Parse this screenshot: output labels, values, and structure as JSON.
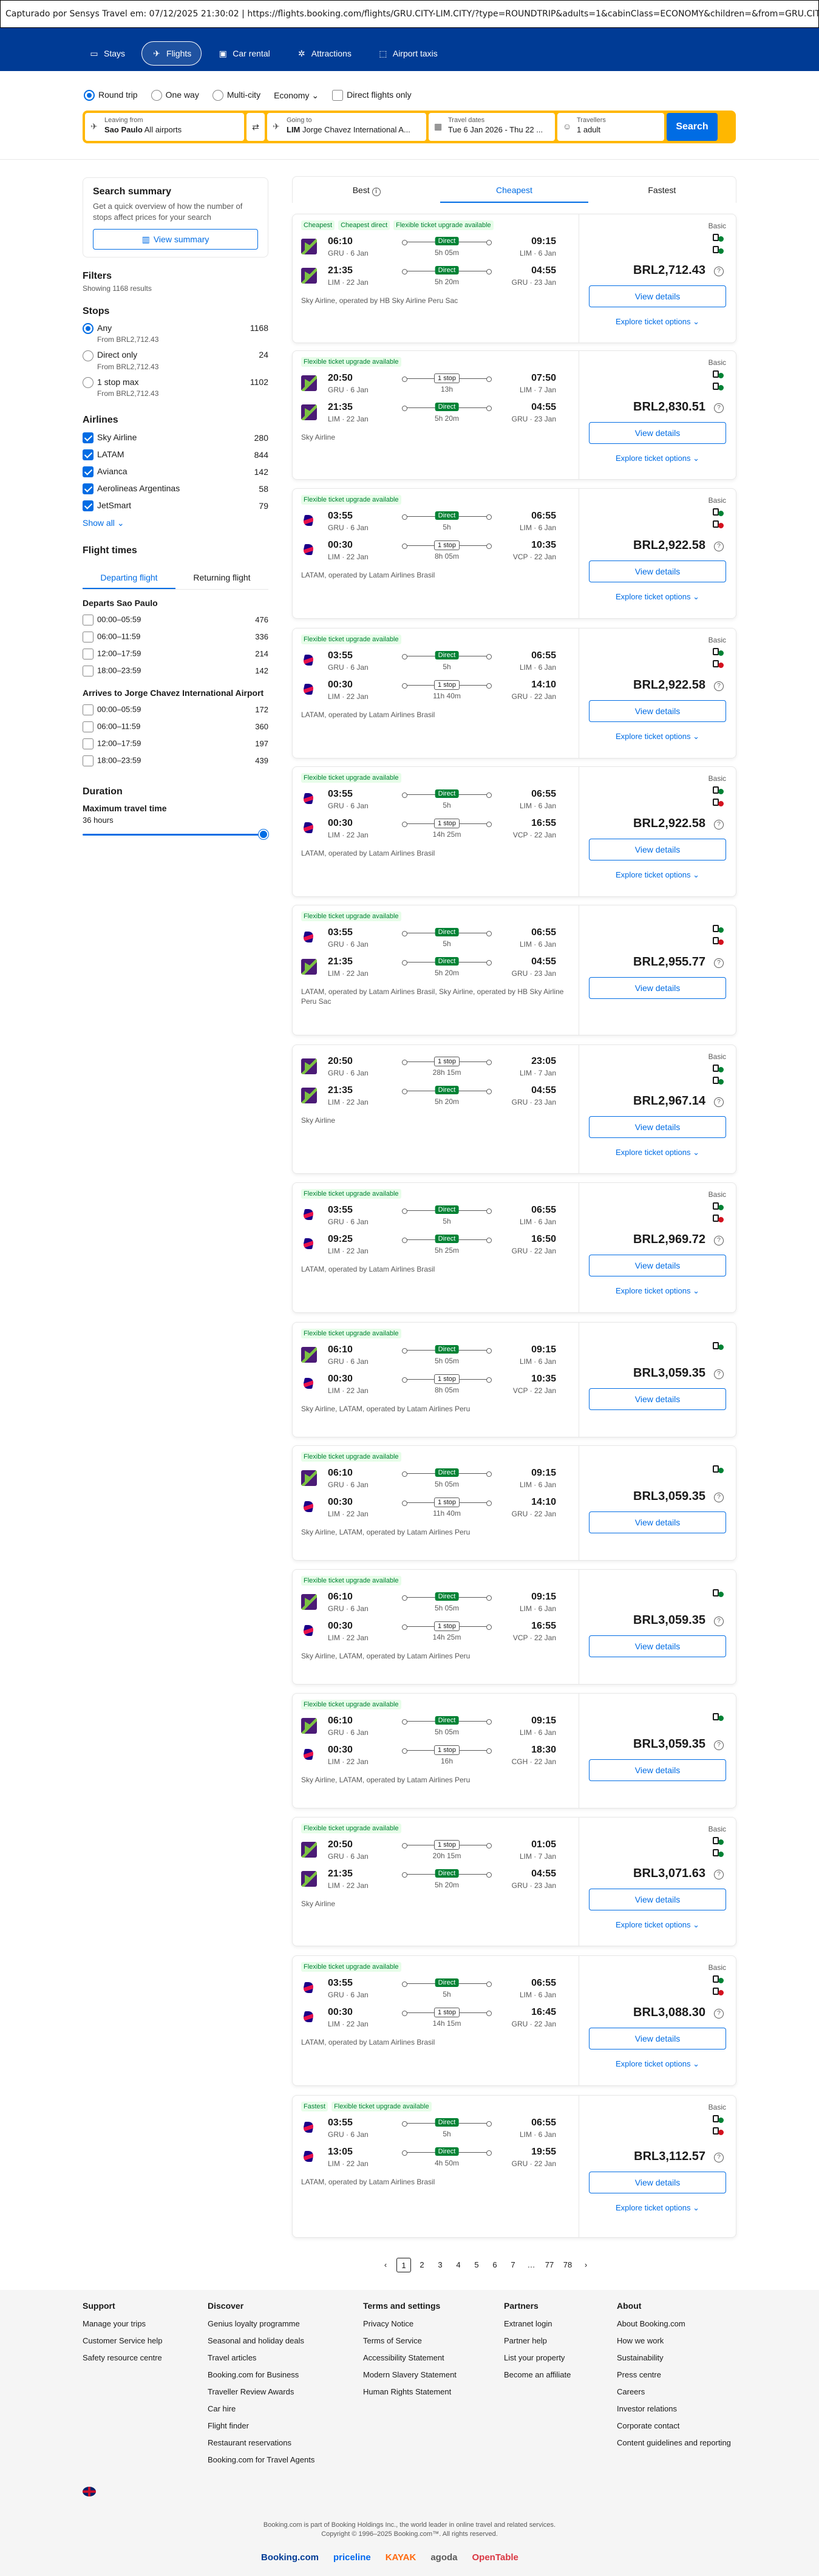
{
  "capture": {
    "text": "Capturado por Sensys Travel em: 07/12/2025 21:30:02  |  https://flights.booking.com/flights/GRU.CITY-LIM.CITY/?type=ROUNDTRIP&adults=1&cabinClass=ECONOMY&children=&from=GRU.CITY&to=LIM.CITY"
  },
  "nav": {
    "items": [
      {
        "label": "Stays",
        "icon": "bed-icon"
      },
      {
        "label": "Flights",
        "icon": "plane-icon"
      },
      {
        "label": "Car rental",
        "icon": "car-icon"
      },
      {
        "label": "Attractions",
        "icon": "attractions-icon"
      },
      {
        "label": "Airport taxis",
        "icon": "taxi-icon"
      }
    ]
  },
  "trip_options": {
    "round_trip": "Round trip",
    "one_way": "One way",
    "multi_city": "Multi-city",
    "cabin": "Economy",
    "direct_only": "Direct flights only"
  },
  "search": {
    "from_label": "Leaving from",
    "from_city": "Sao Paulo",
    "from_detail": "All airports",
    "to_label": "Going to",
    "to_code": "LIM",
    "to_detail": "Jorge Chavez International A...",
    "dates_label": "Travel dates",
    "dates_value": "Tue 6 Jan 2026 - Thu 22 ...",
    "travellers_label": "Travellers",
    "travellers_value": "1 adult",
    "button": "Search"
  },
  "summary": {
    "title": "Search summary",
    "text": "Get a quick overview of how the number of stops affect prices for your search",
    "button": "View summary"
  },
  "filters": {
    "title": "Filters",
    "showing": "Showing 1168 results"
  },
  "stops": {
    "title": "Stops",
    "options": [
      {
        "label": "Any",
        "from": "From BRL2,712.43",
        "count": "1168",
        "selected": true
      },
      {
        "label": "Direct only",
        "from": "From BRL2,712.43",
        "count": "24",
        "selected": false
      },
      {
        "label": "1 stop max",
        "from": "From BRL2,712.43",
        "count": "1102",
        "selected": false
      }
    ]
  },
  "airlines": {
    "title": "Airlines",
    "show_all": "Show all",
    "items": [
      {
        "name": "Sky Airline",
        "count": "280"
      },
      {
        "name": "LATAM",
        "count": "844"
      },
      {
        "name": "Avianca",
        "count": "142"
      },
      {
        "name": "Aerolineas Argentinas",
        "count": "58"
      },
      {
        "name": "JetSmart",
        "count": "79"
      }
    ]
  },
  "flight_times": {
    "title": "Flight times",
    "tab_departing": "Departing flight",
    "tab_returning": "Returning flight",
    "departs_title": "Departs Sao Paulo",
    "departs": [
      {
        "label": "00:00–05:59",
        "count": "476"
      },
      {
        "label": "06:00–11:59",
        "count": "336"
      },
      {
        "label": "12:00–17:59",
        "count": "214"
      },
      {
        "label": "18:00–23:59",
        "count": "142"
      }
    ],
    "arrives_title": "Arrives to Jorge Chavez International Airport",
    "arrives": [
      {
        "label": "00:00–05:59",
        "count": "172"
      },
      {
        "label": "06:00–11:59",
        "count": "360"
      },
      {
        "label": "12:00–17:59",
        "count": "197"
      },
      {
        "label": "18:00–23:59",
        "count": "439"
      }
    ]
  },
  "duration": {
    "title": "Duration",
    "label": "Maximum travel time",
    "value": "36 hours",
    "fill_fraction": 1.0
  },
  "sort": {
    "best": "Best",
    "cheapest": "Cheapest",
    "fastest": "Fastest"
  },
  "labels": {
    "basic": "Basic",
    "view_details": "View details",
    "explore": "Explore ticket options"
  },
  "cards": [
    {
      "badges": [
        "Cheapest",
        "Cheapest direct",
        "Flexible ticket upgrade available"
      ],
      "legs": [
        {
          "logo": "sky",
          "dep": "06:10",
          "dep_ap": "GRU · 6 Jan",
          "stop": "Direct",
          "dur": "5h 05m",
          "arr": "09:15",
          "arr_ap": "LIM · 6 Jan"
        },
        {
          "logo": "sky",
          "dep": "21:35",
          "dep_ap": "LIM · 22 Jan",
          "stop": "Direct",
          "dur": "5h 20m",
          "arr": "04:55",
          "arr_ap": "GRU · 23 Jan"
        }
      ],
      "operator": "Sky Airline, operated by HB Sky Airline Peru Sac",
      "basic": true,
      "price": "BRL2,712.43",
      "bags": [
        "ok",
        "ok"
      ]
    },
    {
      "badges": [
        "Flexible ticket upgrade available"
      ],
      "legs": [
        {
          "logo": "sky",
          "dep": "20:50",
          "dep_ap": "GRU · 6 Jan",
          "stop": "1 stop",
          "dur": "13h",
          "arr": "07:50",
          "arr_ap": "LIM · 7 Jan"
        },
        {
          "logo": "sky",
          "dep": "21:35",
          "dep_ap": "LIM · 22 Jan",
          "stop": "Direct",
          "dur": "5h 20m",
          "arr": "04:55",
          "arr_ap": "GRU · 23 Jan"
        }
      ],
      "operator": "Sky Airline",
      "basic": true,
      "price": "BRL2,830.51",
      "bags": [
        "ok",
        "ok"
      ]
    },
    {
      "badges": [
        "Flexible ticket upgrade available"
      ],
      "legs": [
        {
          "logo": "latam",
          "dep": "03:55",
          "dep_ap": "GRU · 6 Jan",
          "stop": "Direct",
          "dur": "5h",
          "arr": "06:55",
          "arr_ap": "LIM · 6 Jan"
        },
        {
          "logo": "latam",
          "dep": "00:30",
          "dep_ap": "LIM · 22 Jan",
          "stop": "1 stop",
          "dur": "8h 05m",
          "arr": "10:35",
          "arr_ap": "VCP · 22 Jan"
        }
      ],
      "operator": "LATAM, operated by Latam Airlines Brasil",
      "basic": true,
      "price": "BRL2,922.58",
      "bags": [
        "ok",
        "no"
      ]
    },
    {
      "badges": [
        "Flexible ticket upgrade available"
      ],
      "legs": [
        {
          "logo": "latam",
          "dep": "03:55",
          "dep_ap": "GRU · 6 Jan",
          "stop": "Direct",
          "dur": "5h",
          "arr": "06:55",
          "arr_ap": "LIM · 6 Jan"
        },
        {
          "logo": "latam",
          "dep": "00:30",
          "dep_ap": "LIM · 22 Jan",
          "stop": "1 stop",
          "dur": "11h 40m",
          "arr": "14:10",
          "arr_ap": "GRU · 22 Jan"
        }
      ],
      "operator": "LATAM, operated by Latam Airlines Brasil",
      "basic": true,
      "price": "BRL2,922.58",
      "bags": [
        "ok",
        "no"
      ]
    },
    {
      "badges": [
        "Flexible ticket upgrade available"
      ],
      "legs": [
        {
          "logo": "latam",
          "dep": "03:55",
          "dep_ap": "GRU · 6 Jan",
          "stop": "Direct",
          "dur": "5h",
          "arr": "06:55",
          "arr_ap": "LIM · 6 Jan"
        },
        {
          "logo": "latam",
          "dep": "00:30",
          "dep_ap": "LIM · 22 Jan",
          "stop": "1 stop",
          "dur": "14h 25m",
          "arr": "16:55",
          "arr_ap": "VCP · 22 Jan"
        }
      ],
      "operator": "LATAM, operated by Latam Airlines Brasil",
      "basic": true,
      "price": "BRL2,922.58",
      "bags": [
        "ok",
        "no"
      ]
    },
    {
      "badges": [
        "Flexible ticket upgrade available"
      ],
      "legs": [
        {
          "logo": "latam",
          "dep": "03:55",
          "dep_ap": "GRU · 6 Jan",
          "stop": "Direct",
          "dur": "5h",
          "arr": "06:55",
          "arr_ap": "LIM · 6 Jan"
        },
        {
          "logo": "sky",
          "dep": "21:35",
          "dep_ap": "LIM · 22 Jan",
          "stop": "Direct",
          "dur": "5h 20m",
          "arr": "04:55",
          "arr_ap": "GRU · 23 Jan"
        }
      ],
      "operator": "LATAM, operated by Latam Airlines Brasil, Sky Airline, operated by HB Sky Airline Peru Sac",
      "basic": false,
      "price": "BRL2,955.77",
      "bags": [
        "ok",
        "no"
      ]
    },
    {
      "badges": [],
      "legs": [
        {
          "logo": "sky",
          "dep": "20:50",
          "dep_ap": "GRU · 6 Jan",
          "stop": "1 stop",
          "dur": "28h 15m",
          "arr": "23:05",
          "arr_ap": "LIM · 7 Jan"
        },
        {
          "logo": "sky",
          "dep": "21:35",
          "dep_ap": "LIM · 22 Jan",
          "stop": "Direct",
          "dur": "5h 20m",
          "arr": "04:55",
          "arr_ap": "GRU · 23 Jan"
        }
      ],
      "operator": "Sky Airline",
      "basic": true,
      "price": "BRL2,967.14",
      "bags": [
        "ok",
        "ok"
      ]
    },
    {
      "badges": [
        "Flexible ticket upgrade available"
      ],
      "legs": [
        {
          "logo": "latam",
          "dep": "03:55",
          "dep_ap": "GRU · 6 Jan",
          "stop": "Direct",
          "dur": "5h",
          "arr": "06:55",
          "arr_ap": "LIM · 6 Jan"
        },
        {
          "logo": "latam",
          "dep": "09:25",
          "dep_ap": "LIM · 22 Jan",
          "stop": "Direct",
          "dur": "5h 25m",
          "arr": "16:50",
          "arr_ap": "GRU · 22 Jan"
        }
      ],
      "operator": "LATAM, operated by Latam Airlines Brasil",
      "basic": true,
      "price": "BRL2,969.72",
      "bags": [
        "ok",
        "no"
      ]
    },
    {
      "badges": [
        "Flexible ticket upgrade available"
      ],
      "legs": [
        {
          "logo": "sky",
          "dep": "06:10",
          "dep_ap": "GRU · 6 Jan",
          "stop": "Direct",
          "dur": "5h 05m",
          "arr": "09:15",
          "arr_ap": "LIM · 6 Jan"
        },
        {
          "logo": "latam",
          "dep": "00:30",
          "dep_ap": "LIM · 22 Jan",
          "stop": "1 stop",
          "dur": "8h 05m",
          "arr": "10:35",
          "arr_ap": "VCP · 22 Jan"
        }
      ],
      "operator": "Sky Airline, LATAM, operated by Latam Airlines Peru",
      "basic": false,
      "price": "BRL3,059.35",
      "bags": [
        "ok"
      ]
    },
    {
      "badges": [
        "Flexible ticket upgrade available"
      ],
      "legs": [
        {
          "logo": "sky",
          "dep": "06:10",
          "dep_ap": "GRU · 6 Jan",
          "stop": "Direct",
          "dur": "5h 05m",
          "arr": "09:15",
          "arr_ap": "LIM · 6 Jan"
        },
        {
          "logo": "latam",
          "dep": "00:30",
          "dep_ap": "LIM · 22 Jan",
          "stop": "1 stop",
          "dur": "11h 40m",
          "arr": "14:10",
          "arr_ap": "GRU · 22 Jan"
        }
      ],
      "operator": "Sky Airline, LATAM, operated by Latam Airlines Peru",
      "basic": false,
      "price": "BRL3,059.35",
      "bags": [
        "ok"
      ]
    },
    {
      "badges": [
        "Flexible ticket upgrade available"
      ],
      "legs": [
        {
          "logo": "sky",
          "dep": "06:10",
          "dep_ap": "GRU · 6 Jan",
          "stop": "Direct",
          "dur": "5h 05m",
          "arr": "09:15",
          "arr_ap": "LIM · 6 Jan"
        },
        {
          "logo": "latam",
          "dep": "00:30",
          "dep_ap": "LIM · 22 Jan",
          "stop": "1 stop",
          "dur": "14h 25m",
          "arr": "16:55",
          "arr_ap": "VCP · 22 Jan"
        }
      ],
      "operator": "Sky Airline, LATAM, operated by Latam Airlines Peru",
      "basic": false,
      "price": "BRL3,059.35",
      "bags": [
        "ok"
      ]
    },
    {
      "badges": [
        "Flexible ticket upgrade available"
      ],
      "legs": [
        {
          "logo": "sky",
          "dep": "06:10",
          "dep_ap": "GRU · 6 Jan",
          "stop": "Direct",
          "dur": "5h 05m",
          "arr": "09:15",
          "arr_ap": "LIM · 6 Jan"
        },
        {
          "logo": "latam",
          "dep": "00:30",
          "dep_ap": "LIM · 22 Jan",
          "stop": "1 stop",
          "dur": "16h",
          "arr": "18:30",
          "arr_ap": "CGH · 22 Jan"
        }
      ],
      "operator": "Sky Airline, LATAM, operated by Latam Airlines Peru",
      "basic": false,
      "price": "BRL3,059.35",
      "bags": [
        "ok"
      ]
    },
    {
      "badges": [
        "Flexible ticket upgrade available"
      ],
      "legs": [
        {
          "logo": "sky",
          "dep": "20:50",
          "dep_ap": "GRU · 6 Jan",
          "stop": "1 stop",
          "dur": "20h 15m",
          "arr": "01:05",
          "arr_ap": "LIM · 7 Jan"
        },
        {
          "logo": "sky",
          "dep": "21:35",
          "dep_ap": "LIM · 22 Jan",
          "stop": "Direct",
          "dur": "5h 20m",
          "arr": "04:55",
          "arr_ap": "GRU · 23 Jan"
        }
      ],
      "operator": "Sky Airline",
      "basic": true,
      "price": "BRL3,071.63",
      "bags": [
        "ok",
        "ok"
      ]
    },
    {
      "badges": [
        "Flexible ticket upgrade available"
      ],
      "legs": [
        {
          "logo": "latam",
          "dep": "03:55",
          "dep_ap": "GRU · 6 Jan",
          "stop": "Direct",
          "dur": "5h",
          "arr": "06:55",
          "arr_ap": "LIM · 6 Jan"
        },
        {
          "logo": "latam",
          "dep": "00:30",
          "dep_ap": "LIM · 22 Jan",
          "stop": "1 stop",
          "dur": "14h 15m",
          "arr": "16:45",
          "arr_ap": "GRU · 22 Jan"
        }
      ],
      "operator": "LATAM, operated by Latam Airlines Brasil",
      "basic": true,
      "price": "BRL3,088.30",
      "bags": [
        "ok",
        "no"
      ]
    },
    {
      "badges": [
        "Fastest",
        "Flexible ticket upgrade available"
      ],
      "legs": [
        {
          "logo": "latam",
          "dep": "03:55",
          "dep_ap": "GRU · 6 Jan",
          "stop": "Direct",
          "dur": "5h",
          "arr": "06:55",
          "arr_ap": "LIM · 6 Jan"
        },
        {
          "logo": "latam",
          "dep": "13:05",
          "dep_ap": "LIM · 22 Jan",
          "stop": "Direct",
          "dur": "4h 50m",
          "arr": "19:55",
          "arr_ap": "GRU · 22 Jan"
        }
      ],
      "operator": "LATAM, operated by Latam Airlines Brasil",
      "basic": true,
      "price": "BRL3,112.57",
      "bags": [
        "ok",
        "no"
      ]
    }
  ],
  "pagination": {
    "prev": "‹",
    "pages": [
      "1",
      "2",
      "3",
      "4",
      "5",
      "6",
      "7",
      "…",
      "77",
      "78"
    ],
    "next": "›",
    "current": "1"
  },
  "footer": {
    "columns": [
      {
        "title": "Support",
        "links": [
          "Manage your trips",
          "Customer Service help",
          "Safety resource centre"
        ]
      },
      {
        "title": "Discover",
        "links": [
          "Genius loyalty programme",
          "Seasonal and holiday deals",
          "Travel articles",
          "Booking.com for Business",
          "Traveller Review Awards",
          "Car hire",
          "Flight finder",
          "Restaurant reservations",
          "Booking.com for Travel Agents"
        ]
      },
      {
        "title": "Terms and settings",
        "links": [
          "Privacy Notice",
          "Terms of Service",
          "Accessibility Statement",
          "Modern Slavery Statement",
          "Human Rights Statement"
        ]
      },
      {
        "title": "Partners",
        "links": [
          "Extranet login",
          "Partner help",
          "List your property",
          "Become an affiliate"
        ]
      },
      {
        "title": "About",
        "links": [
          "About Booking.com",
          "How we work",
          "Sustainability",
          "Press centre",
          "Careers",
          "Investor relations",
          "Corporate contact",
          "Content guidelines and reporting"
        ]
      }
    ],
    "legal1": "Booking.com is part of Booking Holdings Inc., the world leader in online travel and related services.",
    "legal2": "Copyright © 1996–2025 Booking.com™. All rights reserved.",
    "brands": [
      "Booking.com",
      "priceline",
      "KAYAK",
      "agoda",
      "OpenTable"
    ]
  }
}
